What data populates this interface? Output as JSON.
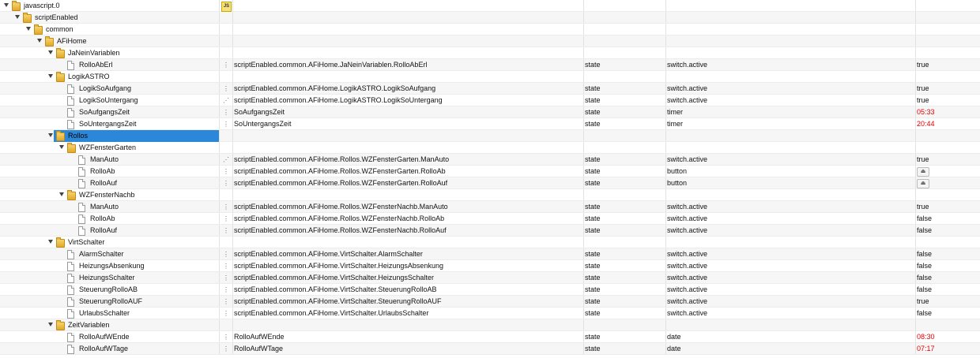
{
  "rows": [
    {
      "name": "javascript.0",
      "level": 0,
      "folder": true,
      "open": true,
      "badge": "JS"
    },
    {
      "name": "scriptEnabled",
      "level": 1,
      "folder": true,
      "open": true
    },
    {
      "name": "common",
      "level": 2,
      "folder": true,
      "open": true
    },
    {
      "name": "AFiHome",
      "level": 3,
      "folder": true,
      "open": true
    },
    {
      "name": "JaNeinVariablen",
      "level": 4,
      "folder": true,
      "open": true
    },
    {
      "name": "RolloAbErl",
      "level": 5,
      "flag": "⋮",
      "id": "scriptEnabled.common.AFiHome.JaNeinVariablen.RolloAbErl",
      "type": "state",
      "role": "switch.active",
      "value": "true"
    },
    {
      "name": "LogikASTRO",
      "level": 4,
      "folder": true,
      "open": true
    },
    {
      "name": "LogikSoAufgang",
      "level": 5,
      "flag": "⋮",
      "id": "scriptEnabled.common.AFiHome.LogikASTRO.LogikSoAufgang",
      "type": "state",
      "role": "switch.active",
      "value": "true"
    },
    {
      "name": "LogikSoUntergang",
      "level": 5,
      "flag": "⋰",
      "id": "scriptEnabled.common.AFiHome.LogikASTRO.LogikSoUntergang",
      "type": "state",
      "role": "switch.active",
      "value": "true"
    },
    {
      "name": "SoAufgangsZeit",
      "level": 5,
      "flag": "⋮",
      "id": "SoAufgangsZeit",
      "type": "state",
      "role": "timer",
      "value": "05:33",
      "red": true
    },
    {
      "name": "SoUntergangsZeit",
      "level": 5,
      "flag": "⋮",
      "id": "SoUntergangsZeit",
      "type": "state",
      "role": "timer",
      "value": "20:44",
      "red": true
    },
    {
      "name": "Rollos",
      "level": 4,
      "folder": true,
      "open": true,
      "selected": true
    },
    {
      "name": "WZFensterGarten",
      "level": 5,
      "folder": true,
      "open": true
    },
    {
      "name": "ManAuto",
      "level": 6,
      "flag": "⋰",
      "id": "scriptEnabled.common.AFiHome.Rollos.WZFensterGarten.ManAuto",
      "type": "state",
      "role": "switch.active",
      "value": "true"
    },
    {
      "name": "RolloAb",
      "level": 6,
      "flag": "⋮",
      "id": "scriptEnabled.common.AFiHome.Rollos.WZFensterGarten.RolloAb",
      "type": "state",
      "role": "button",
      "button": "⏏"
    },
    {
      "name": "RolloAuf",
      "level": 6,
      "flag": "⋮",
      "id": "scriptEnabled.common.AFiHome.Rollos.WZFensterGarten.RolloAuf",
      "type": "state",
      "role": "button",
      "button": "⏏"
    },
    {
      "name": "WZFensterNachb",
      "level": 5,
      "folder": true,
      "open": true
    },
    {
      "name": "ManAuto",
      "level": 6,
      "flag": "⋮",
      "id": "scriptEnabled.common.AFiHome.Rollos.WZFensterNachb.ManAuto",
      "type": "state",
      "role": "switch.active",
      "value": "true"
    },
    {
      "name": "RolloAb",
      "level": 6,
      "flag": "⋮",
      "id": "scriptEnabled.common.AFiHome.Rollos.WZFensterNachb.RolloAb",
      "type": "state",
      "role": "switch.active",
      "value": "false"
    },
    {
      "name": "RolloAuf",
      "level": 6,
      "flag": "⋮",
      "id": "scriptEnabled.common.AFiHome.Rollos.WZFensterNachb.RolloAuf",
      "type": "state",
      "role": "switch.active",
      "value": "false"
    },
    {
      "name": "VirtSchalter",
      "level": 4,
      "folder": true,
      "open": true
    },
    {
      "name": "AlarmSchalter",
      "level": 5,
      "flag": "⋮",
      "id": "scriptEnabled.common.AFiHome.VirtSchalter.AlarmSchalter",
      "type": "state",
      "role": "switch.active",
      "value": "false"
    },
    {
      "name": "HeizungsAbsenkung",
      "level": 5,
      "flag": "⋮",
      "id": "scriptEnabled.common.AFiHome.VirtSchalter.HeizungsAbsenkung",
      "type": "state",
      "role": "switch.active",
      "value": "false"
    },
    {
      "name": "HeizungsSchalter",
      "level": 5,
      "flag": "⋮",
      "id": "scriptEnabled.common.AFiHome.VirtSchalter.HeizungsSchalter",
      "type": "state",
      "role": "switch.active",
      "value": "false"
    },
    {
      "name": "SteuerungRolloAB",
      "level": 5,
      "flag": "⋮",
      "id": "scriptEnabled.common.AFiHome.VirtSchalter.SteuerungRolloAB",
      "type": "state",
      "role": "switch.active",
      "value": "false"
    },
    {
      "name": "SteuerungRolloAUF",
      "level": 5,
      "flag": "⋮",
      "id": "scriptEnabled.common.AFiHome.VirtSchalter.SteuerungRolloAUF",
      "type": "state",
      "role": "switch.active",
      "value": "true"
    },
    {
      "name": "UrlaubsSchalter",
      "level": 5,
      "flag": "⋮",
      "id": "scriptEnabled.common.AFiHome.VirtSchalter.UrlaubsSchalter",
      "type": "state",
      "role": "switch.active",
      "value": "false"
    },
    {
      "name": "ZeitVariablen",
      "level": 4,
      "folder": true,
      "open": true
    },
    {
      "name": "RolloAufWEnde",
      "level": 5,
      "flag": "⋮",
      "id": "RolloAufWEnde",
      "type": "state",
      "role": "date",
      "value": "08:30",
      "red": true
    },
    {
      "name": "RolloAufWTage",
      "level": 5,
      "flag": "⋮",
      "id": "RolloAufWTage",
      "type": "state",
      "role": "date",
      "value": "07:17",
      "red": true
    }
  ]
}
